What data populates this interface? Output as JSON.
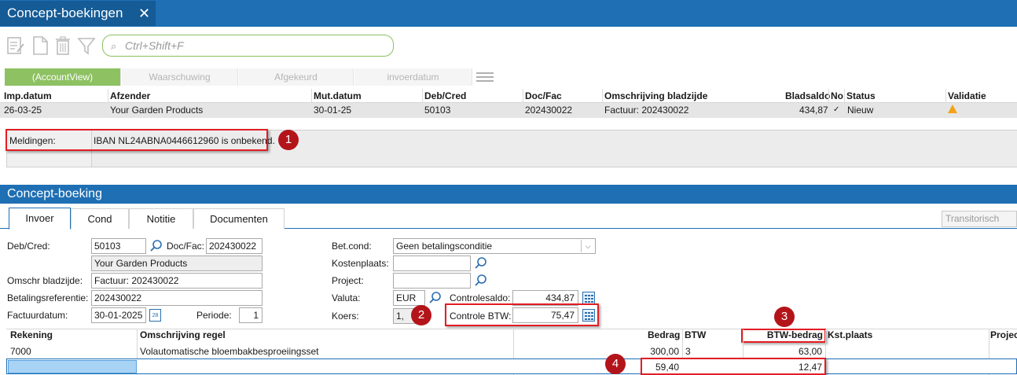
{
  "window": {
    "tab_title": "Concept-boekingen",
    "close_glyph": "✕"
  },
  "toolbar": {
    "icons": [
      "edit-icon",
      "new-document-icon",
      "delete-icon",
      "filter-icon"
    ],
    "search_placeholder": "Ctrl+Shift+F"
  },
  "filters": {
    "tabs": [
      {
        "label": "(AccountView)",
        "active": true
      },
      {
        "label": "Waarschuwing",
        "active": false
      },
      {
        "label": "Afgekeurd",
        "active": false
      },
      {
        "label": "invoerdatum",
        "active": false
      }
    ]
  },
  "grid": {
    "columns": [
      "Imp.datum",
      "Afzender",
      "Mut.datum",
      "Deb/Cred",
      "Doc/Fac",
      "Omschrijving bladzijde",
      "Bladsaldo",
      "No",
      "Status",
      "Validatie"
    ],
    "rows": [
      {
        "imp_datum": "26-03-25",
        "afzender": "Your Garden Products",
        "mut_datum": "30-01-25",
        "deb_cred": "50103",
        "doc_fac": "202430022",
        "omschrijving": "Factuur: 202430022",
        "bladsaldo": "434,87",
        "no": "✓",
        "status": "Nieuw",
        "validatie": "warning-icon"
      }
    ]
  },
  "meldingen": {
    "label": "Meldingen:",
    "message": "IBAN NL24ABNA0446612960 is onbekend."
  },
  "annotations": [
    "1",
    "2",
    "3",
    "4"
  ],
  "annotation_color": "#e21d24",
  "concept": {
    "title": "Concept-boeking",
    "tabs": [
      {
        "label": "Invoer",
        "active": true
      },
      {
        "label": "Cond",
        "active": false
      },
      {
        "label": "Notitie",
        "active": false
      },
      {
        "label": "Documenten",
        "active": false
      }
    ],
    "transit": "Transitorisch",
    "form": {
      "deb_cred_label": "Deb/Cred:",
      "deb_cred_value": "50103",
      "doc_fac_label": "Doc/Fac:",
      "doc_fac_value": "202430022",
      "name_value": "Your Garden Products",
      "omschr_label": "Omschr bladzijde:",
      "omschr_value": "Factuur: 202430022",
      "betref_label": "Betalingsreferentie:",
      "betref_value": "202430022",
      "factdatum_label": "Factuurdatum:",
      "factdatum_value": "30-01-2025",
      "periode_label": "Periode:",
      "periode_value": "1",
      "betcond_label": "Bet.cond:",
      "betcond_value": "Geen betalingsconditie",
      "kostenplaats_label": "Kostenplaats:",
      "project_label": "Project:",
      "valuta_label": "Valuta:",
      "valuta_value": "EUR",
      "controlesaldo_label": "Controlesaldo:",
      "controlesaldo_value": "434,87",
      "koers_label": "Koers:",
      "koers_value": "1,",
      "controlebtw_label": "Controle BTW:",
      "controlebtw_value": "75,47"
    },
    "lines": {
      "columns": [
        "Rekening",
        "Omschrijving regel",
        "Bedrag",
        "BTW",
        "BTW-bedrag",
        "Kst.plaats",
        "Projec"
      ],
      "rows": [
        {
          "rekening": "7000",
          "omschrijving": "Volautomatische bloembakbesproeiingsset",
          "bedrag": "300,00",
          "btw": "3",
          "btw_bedrag": "63,00"
        },
        {
          "rekening": "",
          "omschrijving": "",
          "bedrag": "59,40",
          "btw": "",
          "btw_bedrag": "12,47"
        }
      ]
    }
  }
}
